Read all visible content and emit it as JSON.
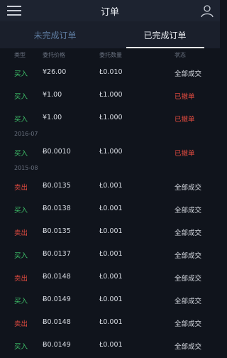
{
  "header": {
    "title": "订单"
  },
  "tabs": [
    {
      "label": "未完成订单",
      "active": false
    },
    {
      "label": "已完成订单",
      "active": true
    }
  ],
  "columns": {
    "type": "类型",
    "price": "委托价格",
    "qty": "委托数量",
    "status": "状态"
  },
  "groups": [
    {
      "section": "",
      "rows": [
        {
          "type": "买入",
          "side": "buy",
          "price": "¥26.00",
          "qty": "Ł0.010",
          "status": "全部成交",
          "status_kind": "done"
        },
        {
          "type": "买入",
          "side": "buy",
          "price": "¥1.00",
          "qty": "Ł1.000",
          "status": "已撤单",
          "status_kind": "cancel"
        },
        {
          "type": "买入",
          "side": "buy",
          "price": "¥1.00",
          "qty": "Ł1.000",
          "status": "已撤单",
          "status_kind": "cancel"
        }
      ]
    },
    {
      "section": "2016-07",
      "rows": [
        {
          "type": "买入",
          "side": "buy",
          "price": "Ƀ0.0010",
          "qty": "Ł1.000",
          "status": "已撤单",
          "status_kind": "cancel"
        }
      ]
    },
    {
      "section": "2015-08",
      "rows": [
        {
          "type": "卖出",
          "side": "sell",
          "price": "Ƀ0.0135",
          "qty": "Ł0.001",
          "status": "全部成交",
          "status_kind": "done"
        },
        {
          "type": "买入",
          "side": "buy",
          "price": "Ƀ0.0138",
          "qty": "Ł0.001",
          "status": "全部成交",
          "status_kind": "done"
        },
        {
          "type": "卖出",
          "side": "sell",
          "price": "Ƀ0.0135",
          "qty": "Ł0.001",
          "status": "全部成交",
          "status_kind": "done"
        },
        {
          "type": "买入",
          "side": "buy",
          "price": "Ƀ0.0137",
          "qty": "Ł0.001",
          "status": "全部成交",
          "status_kind": "done"
        },
        {
          "type": "卖出",
          "side": "sell",
          "price": "Ƀ0.0148",
          "qty": "Ł0.001",
          "status": "全部成交",
          "status_kind": "done"
        },
        {
          "type": "买入",
          "side": "buy",
          "price": "Ƀ0.0149",
          "qty": "Ł0.001",
          "status": "全部成交",
          "status_kind": "done"
        },
        {
          "type": "卖出",
          "side": "sell",
          "price": "Ƀ0.0148",
          "qty": "Ł0.001",
          "status": "全部成交",
          "status_kind": "done"
        },
        {
          "type": "买入",
          "side": "buy",
          "price": "Ƀ0.0149",
          "qty": "Ł0.001",
          "status": "全部成交",
          "status_kind": "done"
        }
      ]
    }
  ],
  "colors": {
    "buy": "#3fc46b",
    "sell": "#e04a3f",
    "cancel": "#e04a3f",
    "background": "#10141c",
    "header": "#1d2330"
  },
  "icons": {
    "menu": "menu-icon",
    "user": "user-icon"
  }
}
